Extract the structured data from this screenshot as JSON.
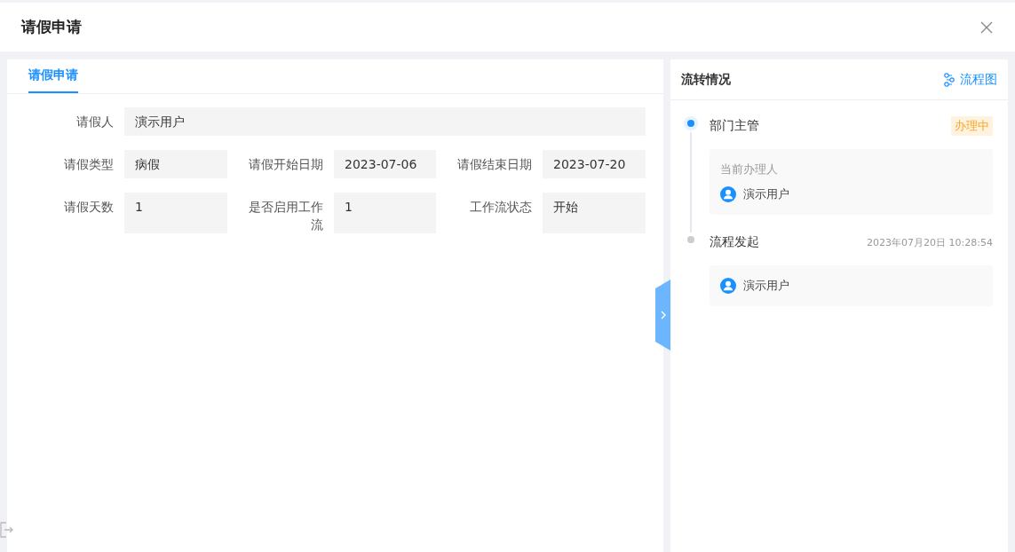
{
  "dialog": {
    "title": "请假申请"
  },
  "tabs": [
    {
      "label": "请假申请",
      "selected": true
    }
  ],
  "form": {
    "rows": [
      [
        {
          "label": "请假人",
          "value": "演示用户"
        }
      ],
      [
        {
          "label": "请假类型",
          "value": "病假"
        },
        {
          "label": "请假开始日期",
          "value": "2023-07-06"
        },
        {
          "label": "请假结束日期",
          "value": "2023-07-20"
        }
      ],
      [
        {
          "label": "请假天数",
          "value": "1"
        },
        {
          "label": "是否启用工作流",
          "value": "1"
        },
        {
          "label": "工作流状态",
          "value": "开始"
        }
      ]
    ]
  },
  "flow": {
    "title": "流转情况",
    "diagram_link": "流程图",
    "steps": [
      {
        "name": "部门主管",
        "active": true,
        "badge": "办理中",
        "handler_label": "当前办理人",
        "users": [
          "演示用户"
        ]
      },
      {
        "name": "流程发起",
        "active": false,
        "time": "2023年07月20日 10:28:54",
        "users": [
          "演示用户"
        ]
      }
    ]
  }
}
